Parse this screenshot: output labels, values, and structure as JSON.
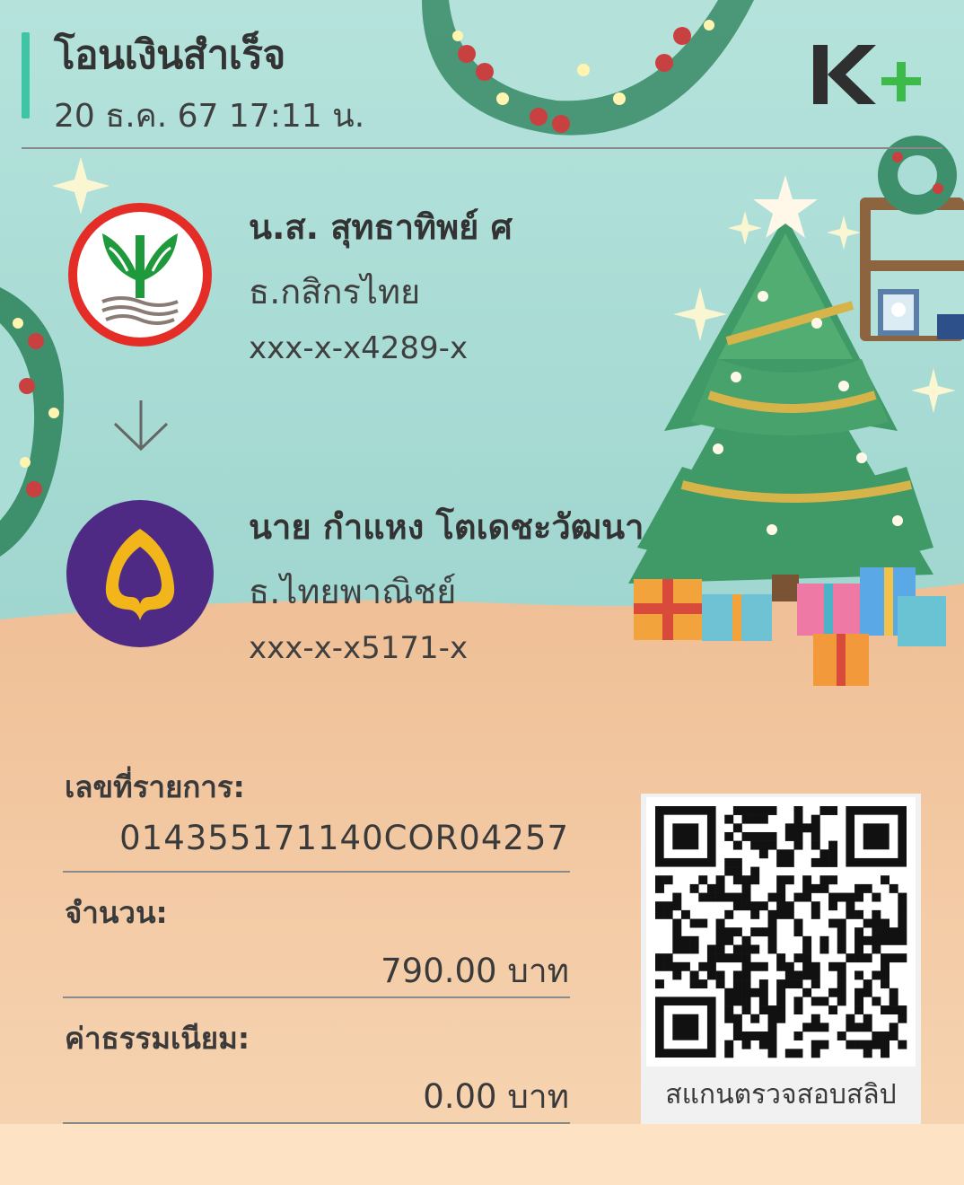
{
  "header": {
    "title": "โอนเงินสำเร็จ",
    "datetime": "20 ธ.ค. 67  17:11 น.",
    "brand_logo": "K+"
  },
  "sender": {
    "name": "น.ส. สุทธาทิพย์ ศ",
    "bank": "ธ.กสิกรไทย",
    "account": "xxx-x-x4289-x",
    "bank_icon": "kasikorn-bank-logo",
    "bank_color": "#138f2d"
  },
  "receiver": {
    "name": "นาย กำแหง โตเดชะวัฒนา",
    "bank": "ธ.ไทยพาณิชย์",
    "account": "xxx-x-x5171-x",
    "bank_icon": "scb-bank-logo",
    "bank_color": "#4e2a84"
  },
  "details": {
    "ref_label": "เลขที่รายการ:",
    "ref_value": "014355171140COR04257",
    "amount_label": "จำนวน:",
    "amount_value": "790.00 บาท",
    "fee_label": "ค่าธรรมเนียม:",
    "fee_value": "0.00 บาท"
  },
  "qr": {
    "caption": "สแกนตรวจสอบสลิป"
  },
  "colors": {
    "accent": "#3fc5a6",
    "sky": "#a9ddd6",
    "floor": "#f2c59c",
    "kplus_green": "#3dbb4a"
  }
}
